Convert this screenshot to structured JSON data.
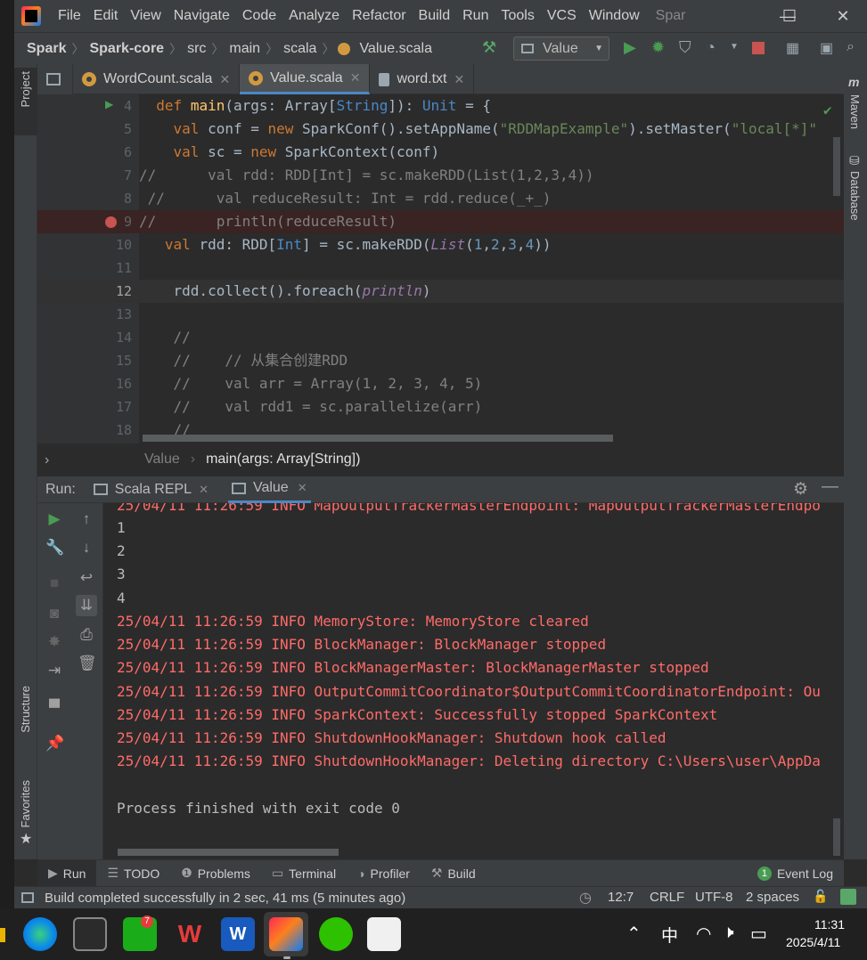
{
  "menubar": {
    "items": [
      "File",
      "Edit",
      "View",
      "Navigate",
      "Code",
      "Analyze",
      "Refactor",
      "Build",
      "Run",
      "Tools",
      "VCS",
      "Window"
    ],
    "project_name": "Spar",
    "controls": {
      "minimize": "—",
      "maximize": "☐",
      "close": "✕"
    }
  },
  "navbar": {
    "breadcrumbs": [
      "Spark",
      "Spark-core",
      "src",
      "main",
      "scala",
      "Value.scala"
    ],
    "run_config": "Value"
  },
  "left_strip": {
    "project_label": "Project",
    "structure_label": "Structure",
    "favorites_label": "Favorites"
  },
  "right_strip": {
    "maven_label": "Maven",
    "database_label": "Database"
  },
  "editor_tabs": [
    {
      "label": "WordCount.scala",
      "active": false,
      "kind": "scala"
    },
    {
      "label": "Value.scala",
      "active": true,
      "kind": "scala"
    },
    {
      "label": "word.txt",
      "active": false,
      "kind": "text"
    }
  ],
  "editor": {
    "lines": [
      {
        "num": "4",
        "text": "  def main(args: Array[String]): Unit = {"
      },
      {
        "num": "5",
        "text": "    val conf = new SparkConf().setAppName(\"RDDMapExample\").setMaster(\"local[*]\""
      },
      {
        "num": "6",
        "text": "    val sc = new SparkContext(conf)"
      },
      {
        "num": "7",
        "text": "//      val rdd: RDD[Int] = sc.makeRDD(List(1,2,3,4))"
      },
      {
        "num": "8",
        "text": " //      val reduceResult: Int = rdd.reduce(_+_)"
      },
      {
        "num": "9",
        "text": "//       println(reduceResult)"
      },
      {
        "num": "10",
        "text": "   val rdd: RDD[Int] = sc.makeRDD(List(1,2,3,4))"
      },
      {
        "num": "11",
        "text": ""
      },
      {
        "num": "12",
        "text": "    rdd.collect().foreach(println)"
      },
      {
        "num": "13",
        "text": ""
      },
      {
        "num": "14",
        "text": "    //"
      },
      {
        "num": "15",
        "text": "    //    // 从集合创建RDD"
      },
      {
        "num": "16",
        "text": "    //    val arr = Array(1, 2, 3, 4, 5)"
      },
      {
        "num": "17",
        "text": "    //    val rdd1 = sc.parallelize(arr)"
      },
      {
        "num": "18",
        "text": "    //"
      }
    ]
  },
  "code_breadcrumb": {
    "object": "Value",
    "method": "main(args: Array[String])"
  },
  "run_panel": {
    "label": "Run:",
    "tabs": [
      "Scala REPL",
      "Value"
    ],
    "console_lines": [
      {
        "kind": "info",
        "text": "25/04/11 11:26:59 INFO MapOutputTrackerMasterEndpoint: MapOutputTrackerMasterEndpo"
      },
      {
        "kind": "out",
        "text": "1"
      },
      {
        "kind": "out",
        "text": "2"
      },
      {
        "kind": "out",
        "text": "3"
      },
      {
        "kind": "out",
        "text": "4"
      },
      {
        "kind": "info",
        "text": "25/04/11 11:26:59 INFO MemoryStore: MemoryStore cleared"
      },
      {
        "kind": "info",
        "text": "25/04/11 11:26:59 INFO BlockManager: BlockManager stopped"
      },
      {
        "kind": "info",
        "text": "25/04/11 11:26:59 INFO BlockManagerMaster: BlockManagerMaster stopped"
      },
      {
        "kind": "info",
        "text": "25/04/11 11:26:59 INFO OutputCommitCoordinator$OutputCommitCoordinatorEndpoint: Ou"
      },
      {
        "kind": "info",
        "text": "25/04/11 11:26:59 INFO SparkContext: Successfully stopped SparkContext"
      },
      {
        "kind": "info",
        "text": "25/04/11 11:26:59 INFO ShutdownHookManager: Shutdown hook called"
      },
      {
        "kind": "info",
        "text": "25/04/11 11:26:59 INFO ShutdownHookManager: Deleting directory C:\\Users\\user\\AppDa"
      },
      {
        "kind": "out",
        "text": ""
      },
      {
        "kind": "out",
        "text": "Process finished with exit code 0"
      }
    ]
  },
  "bottom_tabs": [
    "Run",
    "TODO",
    "Problems",
    "Terminal",
    "Profiler",
    "Build"
  ],
  "event_log": {
    "count": "1",
    "label": "Event Log"
  },
  "status_bar": {
    "message": "Build completed successfully in 2 sec, 41 ms (5 minutes ago)",
    "position": "12:7",
    "line_sep": "CRLF",
    "encoding": "UTF-8",
    "indent": "2 spaces"
  },
  "taskbar": {
    "wechat_badge": "7",
    "ime": "中",
    "time": "11:31",
    "date": "2025/4/11"
  },
  "colors": {
    "accent": "#4a88c7",
    "error": "#ff6b68",
    "keyword": "#cc7832"
  }
}
